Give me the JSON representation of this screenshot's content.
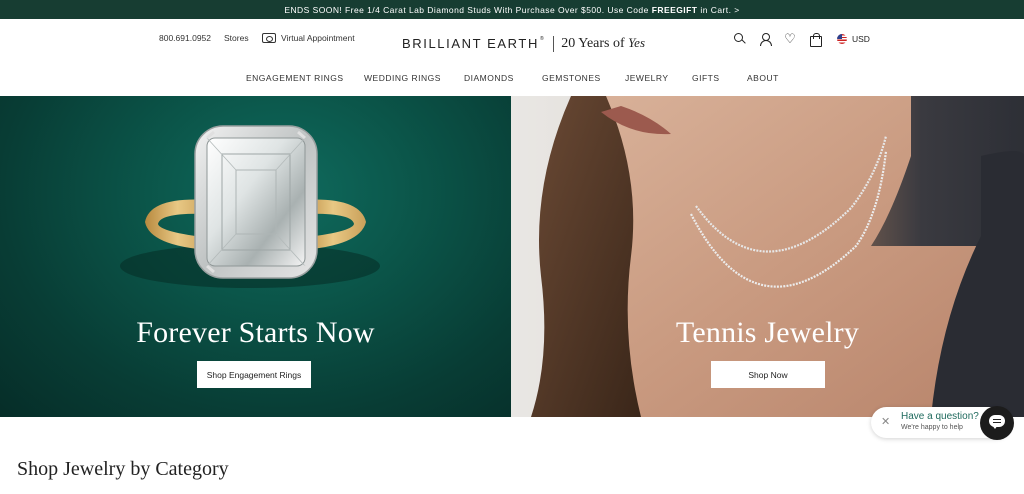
{
  "promo": {
    "text_before": "ENDS SOON! Free 1/4 Carat Lab Diamond Studs With Purchase Over $500. Use Code",
    "code": "FREEGIFT",
    "text_after": "in Cart. >"
  },
  "header": {
    "phone": "800.691.0952",
    "stores": "Stores",
    "appointment": "Virtual Appointment",
    "logo_brand": "BRILLIANT EARTH",
    "logo_tm": "®",
    "logo_years": "20 Years of",
    "logo_yes": "Yes",
    "currency": "USD",
    "heart_glyph": "♡"
  },
  "nav": {
    "items": [
      "ENGAGEMENT RINGS",
      "WEDDING RINGS",
      "DIAMONDS",
      "GEMSTONES",
      "JEWELRY",
      "GIFTS",
      "ABOUT"
    ]
  },
  "hero": {
    "left": {
      "title": "Forever Starts Now",
      "button": "Shop Engagement Rings"
    },
    "right": {
      "title": "Tennis Jewelry",
      "button": "Shop Now"
    }
  },
  "chat": {
    "close": "✕",
    "question": "Have a question?",
    "subtitle": "We're happy to help"
  },
  "section": {
    "title": "Shop Jewelry by Category"
  },
  "colors": {
    "promo_bg": "#173d32",
    "accent_green": "#1e6a5d",
    "hero_left_bg": "#0b5549"
  },
  "icons": [
    "search-icon",
    "account-icon",
    "heart-icon",
    "bag-icon",
    "us-flag-icon",
    "camera-icon",
    "chat-icon",
    "close-icon"
  ]
}
